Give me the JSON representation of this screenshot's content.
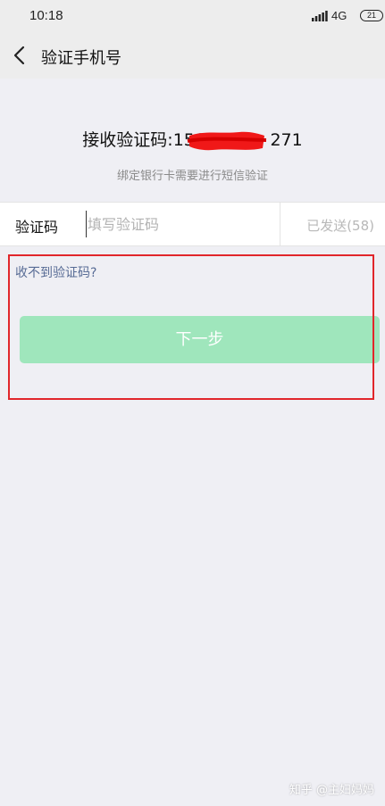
{
  "status_bar": {
    "time": "10:18",
    "network": "4G",
    "battery": "21"
  },
  "nav": {
    "title": "验证手机号"
  },
  "phone": {
    "label": "接收验证码:",
    "number_visible": "158",
    "number_end": "271"
  },
  "subtitle": "绑定银行卡需要进行短信验证",
  "code_field": {
    "label": "验证码",
    "placeholder": "填写验证码",
    "value": "",
    "resend_status": "已发送(58)"
  },
  "no_code_link": "收不到验证码?",
  "next_button": "下一步",
  "watermark": "知乎 @主妇妈妈",
  "colors": {
    "page_bg": "#efeff4",
    "header_bg": "#ededed",
    "button_bg": "#9fe6bc",
    "link": "#576b95",
    "highlight": "#e1262b"
  }
}
